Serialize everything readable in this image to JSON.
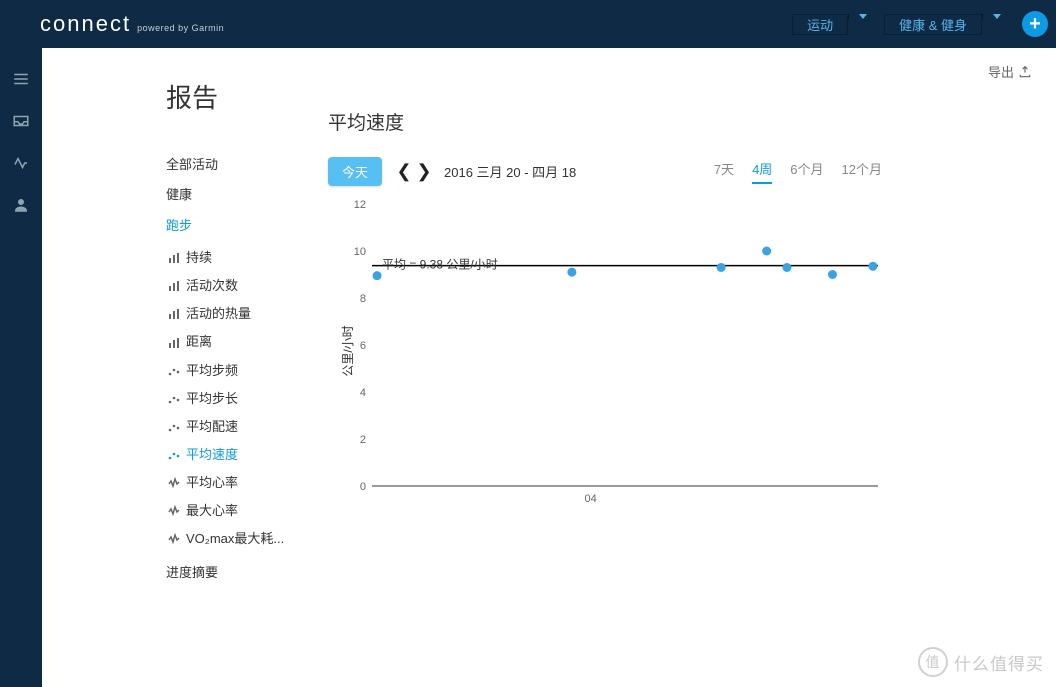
{
  "header": {
    "logo_main": "connect",
    "logo_sub": "powered by Garmin",
    "nav_sport": "运动",
    "nav_health": "健康 & 健身"
  },
  "rail": {
    "menu": "menu",
    "inbox": "inbox",
    "activity": "activity",
    "profile": "profile"
  },
  "export": {
    "label": "导出"
  },
  "page": {
    "title": "报告"
  },
  "sidenav": {
    "groups": [
      {
        "label": "全部活动",
        "active": false
      },
      {
        "label": "健康",
        "active": false
      },
      {
        "label": "跑步",
        "active": true
      },
      {
        "label": "进度摘要",
        "active": false
      }
    ],
    "running_items": [
      {
        "label": "持续",
        "icon": "bars"
      },
      {
        "label": "活动次数",
        "icon": "bars"
      },
      {
        "label": "活动的热量",
        "icon": "bars"
      },
      {
        "label": "距离",
        "icon": "bars"
      },
      {
        "label": "平均步频",
        "icon": "dots"
      },
      {
        "label": "平均步长",
        "icon": "dots"
      },
      {
        "label": "平均配速",
        "icon": "dots"
      },
      {
        "label": "平均速度",
        "icon": "dots",
        "active": true
      },
      {
        "label": "平均心率",
        "icon": "pulse"
      },
      {
        "label": "最大心率",
        "icon": "pulse"
      },
      {
        "label": "VO₂max最大耗...",
        "icon": "pulse"
      }
    ]
  },
  "chart": {
    "title": "平均速度",
    "today": "今天",
    "date_range": "2016 三月 20 - 四月 18",
    "periods": [
      {
        "label": "7天",
        "active": false
      },
      {
        "label": "4周",
        "active": true
      },
      {
        "label": "6个月",
        "active": false
      },
      {
        "label": "12个月",
        "active": false
      }
    ],
    "avg_label": "平均 = 9.38 公里/小时",
    "ylabel": "公里/小时",
    "xlabel_center": "04"
  },
  "chart_data": {
    "type": "scatter",
    "title": "平均速度",
    "xlabel": "",
    "ylabel": "公里/小时",
    "ylim": [
      0,
      12
    ],
    "yticks": [
      0,
      2,
      4,
      6,
      8,
      10,
      12
    ],
    "avg_line": 9.38,
    "x_fraction_0_1": [
      0.01,
      0.395,
      0.69,
      0.78,
      0.82,
      0.91,
      0.99
    ],
    "values": [
      8.95,
      9.1,
      9.3,
      10.0,
      9.3,
      9.0,
      9.35
    ]
  },
  "watermark": {
    "text": "什么值得买",
    "badge": "值"
  }
}
